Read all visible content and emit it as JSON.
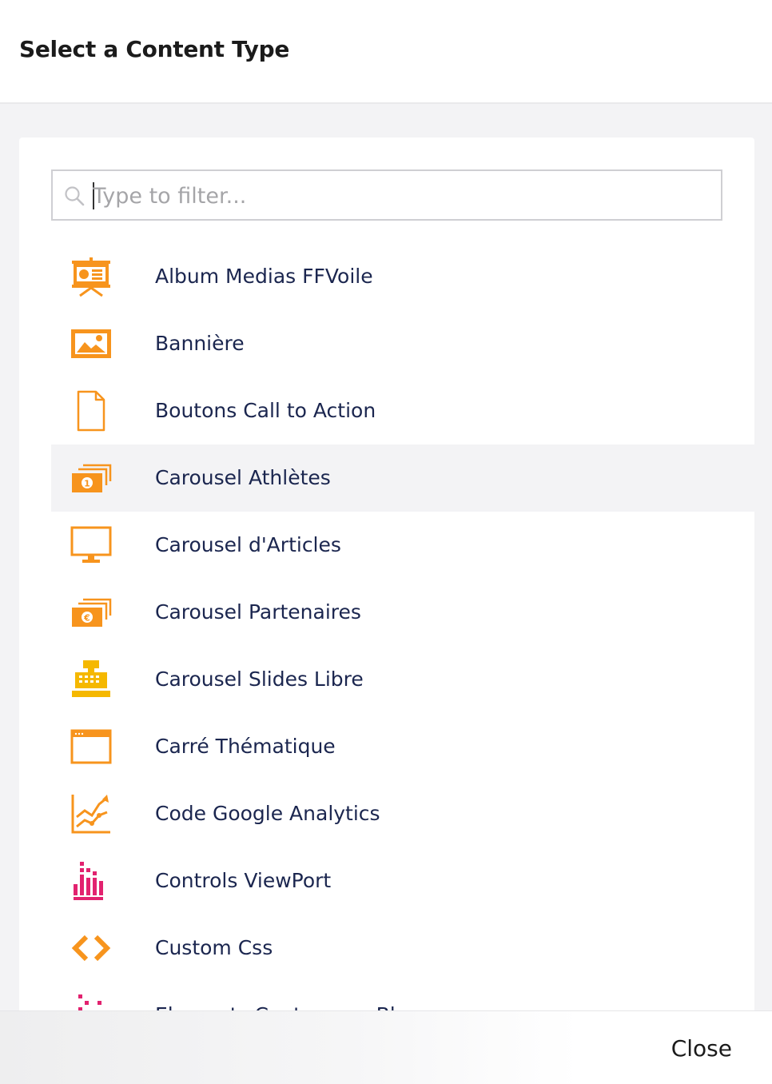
{
  "dialog": {
    "title": "Select a Content Type",
    "close_label": "Close"
  },
  "filter": {
    "placeholder": "Type to filter...",
    "value": ""
  },
  "colors": {
    "orange": "#f7941d",
    "gold": "#f5b800",
    "pink": "#e2226f",
    "text": "#1b264f"
  },
  "content_types": [
    {
      "label": "Album Medias FFVoile",
      "icon": "presentation-board-icon"
    },
    {
      "label": "Bannière",
      "icon": "picture-icon"
    },
    {
      "label": "Boutons Call to Action",
      "icon": "document-icon"
    },
    {
      "label": "Carousel Athlètes",
      "icon": "stacked-bills-icon"
    },
    {
      "label": "Carousel d'Articles",
      "icon": "monitor-icon"
    },
    {
      "label": "Carousel Partenaires",
      "icon": "stacked-euro-bills-icon"
    },
    {
      "label": "Carousel Slides Libre",
      "icon": "cash-register-icon"
    },
    {
      "label": "Carré Thématique",
      "icon": "browser-window-icon"
    },
    {
      "label": "Code Google Analytics",
      "icon": "line-chart-icon"
    },
    {
      "label": "Controls ViewPort",
      "icon": "pixel-grid-icon"
    },
    {
      "label": "Custom Css",
      "icon": "code-brackets-icon"
    },
    {
      "label": "Elements Conteneurs Bloc",
      "icon": "pixel-dots-icon"
    }
  ]
}
